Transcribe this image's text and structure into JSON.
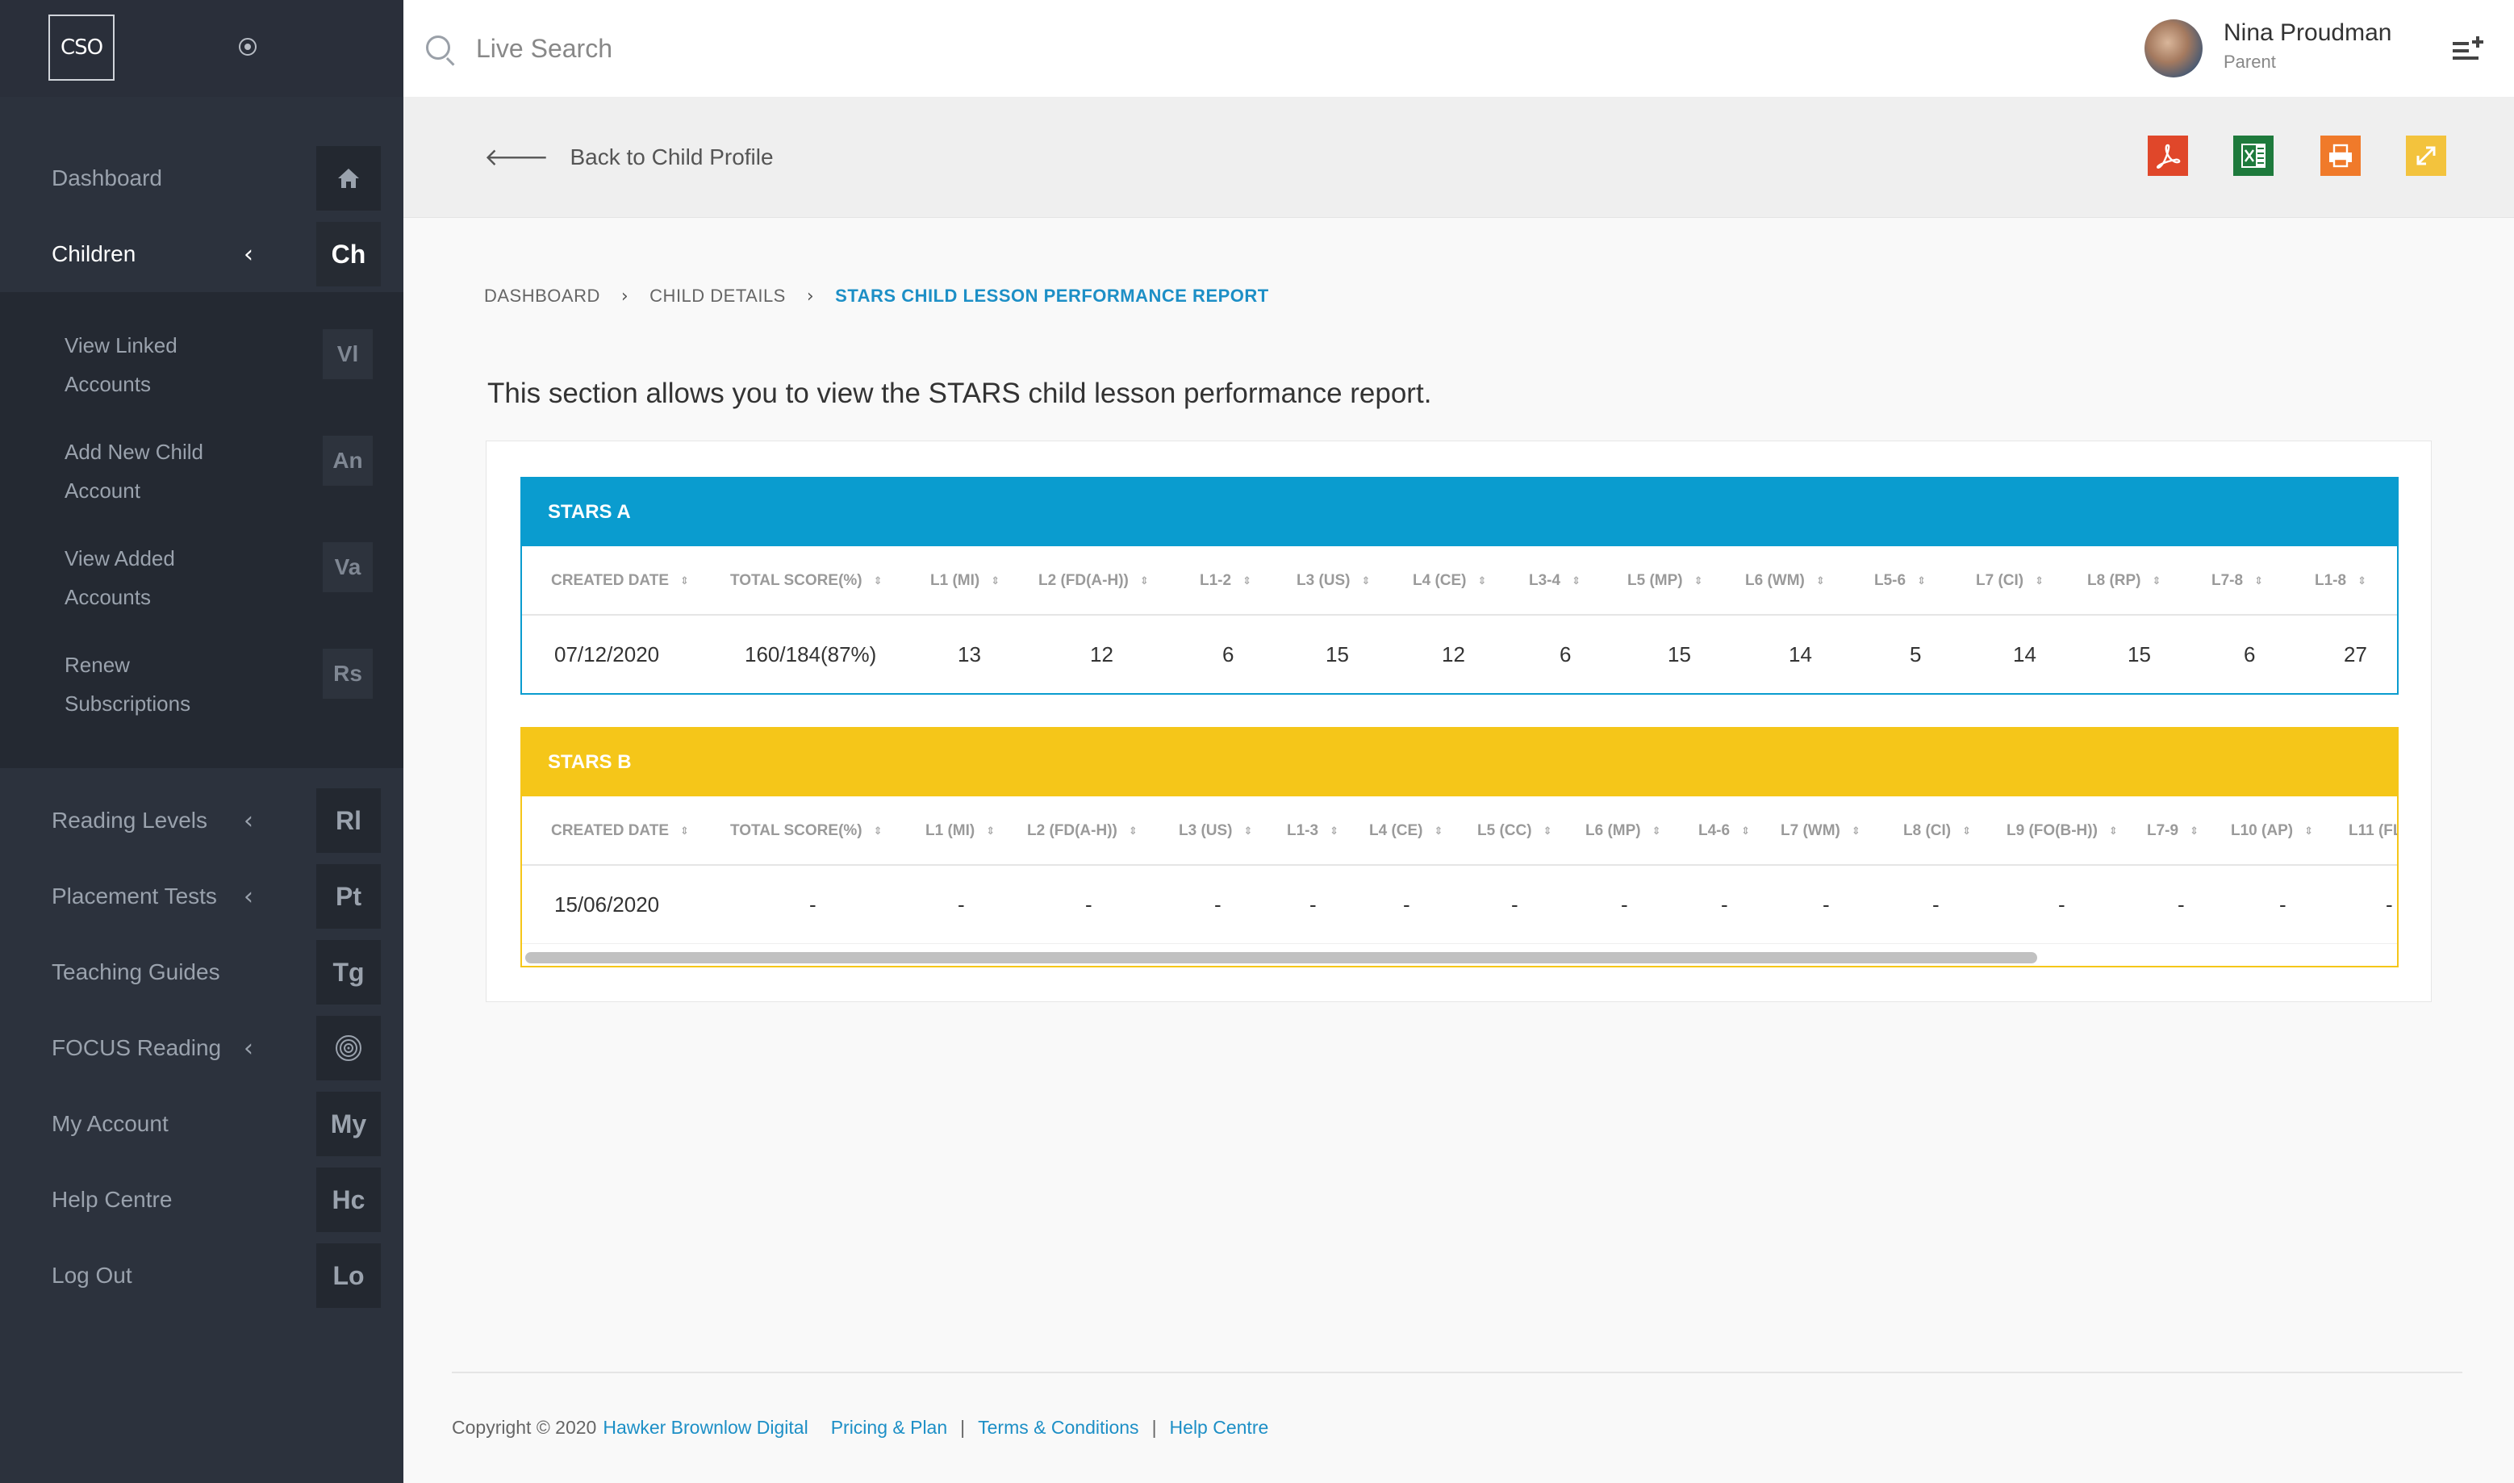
{
  "sidebar": {
    "logo": "CSO",
    "items": [
      {
        "label": "Dashboard",
        "badge": "",
        "icon": "home-icon"
      },
      {
        "label": "Children",
        "badge": "Ch",
        "active": true
      },
      {
        "label": "Reading Levels",
        "badge": "Rl"
      },
      {
        "label": "Placement Tests",
        "badge": "Pt"
      },
      {
        "label": "Teaching Guides",
        "badge": "Tg"
      },
      {
        "label": "FOCUS Reading",
        "badge": "",
        "icon": "target-icon"
      },
      {
        "label": "My Account",
        "badge": "My"
      },
      {
        "label": "Help Centre",
        "badge": "Hc"
      },
      {
        "label": "Log Out",
        "badge": "Lo"
      }
    ],
    "children_sub": [
      {
        "label": "View Linked Accounts",
        "badge": "Vl"
      },
      {
        "label": "Add New Child Account",
        "badge": "An"
      },
      {
        "label": "View Added Accounts",
        "badge": "Va"
      },
      {
        "label": "Renew Subscriptions",
        "badge": "Rs"
      }
    ]
  },
  "search": {
    "placeholder": "Live Search"
  },
  "user": {
    "name": "Nina Proudman",
    "role": "Parent"
  },
  "toolbar": {
    "back_label": "Back to Child Profile",
    "colors": {
      "pdf": "#e0472a",
      "excel": "#1e7a3c",
      "print": "#f07a2a",
      "expand": "#f3c33d"
    }
  },
  "breadcrumb": [
    "DASHBOARD",
    "CHILD DETAILS",
    "STARS CHILD LESSON PERFORMANCE REPORT"
  ],
  "intro": "This section allows you to view the STARS child lesson performance report.",
  "reports": [
    {
      "title": "STARS A",
      "color": "#0a9ccf",
      "columns": [
        "CREATED DATE",
        "TOTAL SCORE(%)",
        "L1 (MI)",
        "L2 (FD(A-H))",
        "L1-2",
        "L3 (US)",
        "L4 (CE)",
        "L3-4",
        "L5 (MP)",
        "L6 (WM)",
        "L5-6",
        "L7 (CI)",
        "L8 (RP)",
        "L7-8",
        "L1-8"
      ],
      "rows": [
        [
          "07/12/2020",
          "160/184(87%)",
          "13",
          "12",
          "6",
          "15",
          "12",
          "6",
          "15",
          "14",
          "5",
          "14",
          "15",
          "6",
          "27"
        ]
      ]
    },
    {
      "title": "STARS B",
      "color": "#f5c619",
      "columns": [
        "CREATED DATE",
        "TOTAL SCORE(%)",
        "L1 (MI)",
        "L2 (FD(A-H))",
        "L3 (US)",
        "L1-3",
        "L4 (CE)",
        "L5 (CC)",
        "L6 (MP)",
        "L4-6",
        "L7 (WM)",
        "L8 (CI)",
        "L9 (FO(B-H))",
        "L7-9",
        "L10 (AP)",
        "L11 (FL"
      ],
      "rows": [
        [
          "15/06/2020",
          "-",
          "-",
          "-",
          "-",
          "-",
          "-",
          "-",
          "-",
          "-",
          "-",
          "-",
          "-",
          "-",
          "-",
          "-"
        ]
      ]
    }
  ],
  "footer": {
    "copyright": "Copyright © 2020",
    "company": "Hawker Brownlow Digital",
    "links": [
      "Pricing & Plan",
      "Terms & Conditions",
      "Help Centre"
    ]
  }
}
